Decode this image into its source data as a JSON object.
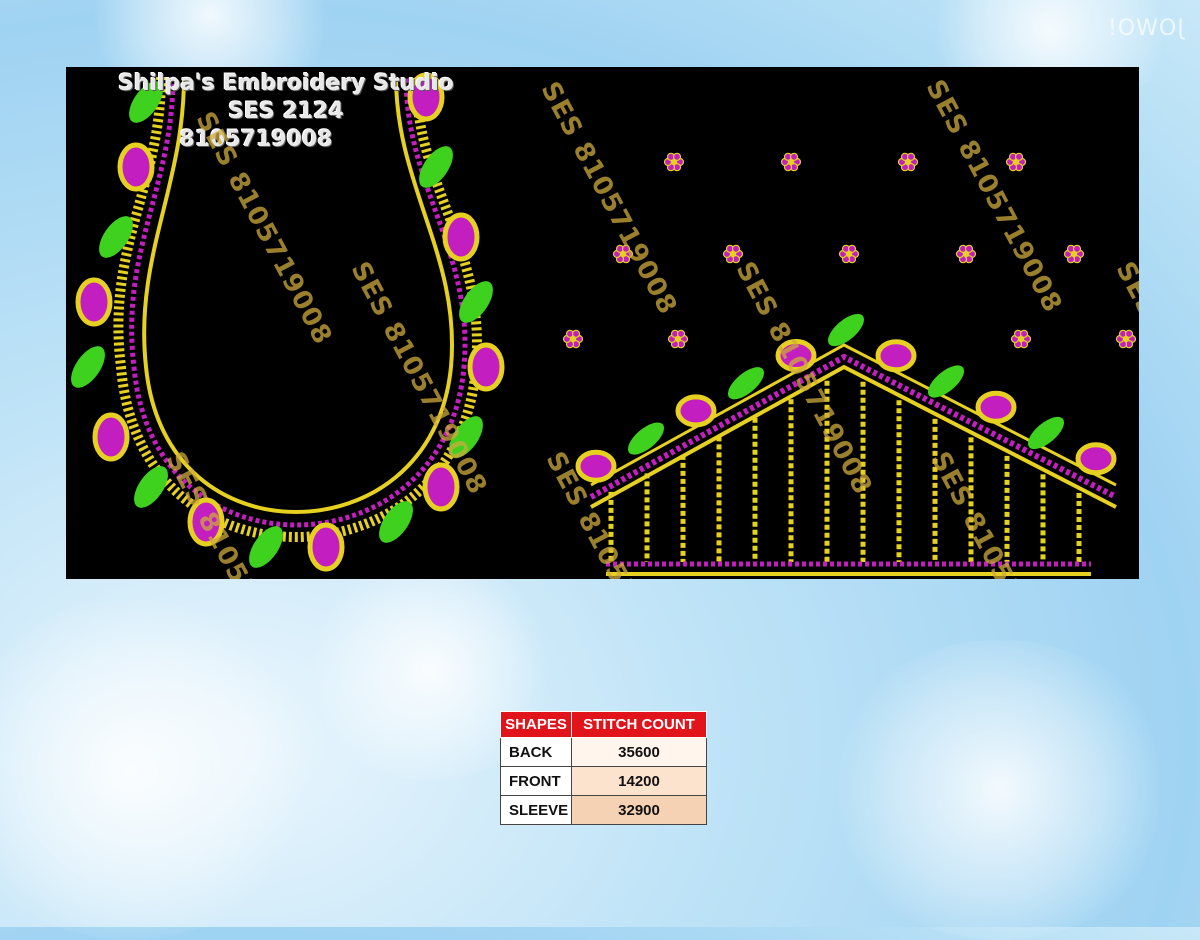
{
  "header": {
    "studio_name": "Shilpa's Embroidery Studio",
    "design_code": "SES 2124",
    "phone": "8105719008"
  },
  "watermark_text": "SES 8105719008",
  "corner_mark": "JOWO!",
  "stitch_table": {
    "headers": [
      "SHAPES",
      "STITCH COUNT"
    ],
    "rows": [
      {
        "shape": "BACK",
        "count": "35600"
      },
      {
        "shape": "FRONT",
        "count": "14200"
      },
      {
        "shape": "SLEEVE",
        "count": "32900"
      }
    ]
  },
  "colors": {
    "panel_bg": "#000000",
    "gold": "#e6d020",
    "magenta": "#c21ec0",
    "green": "#3ed21e",
    "header_red": "#e1141c"
  }
}
